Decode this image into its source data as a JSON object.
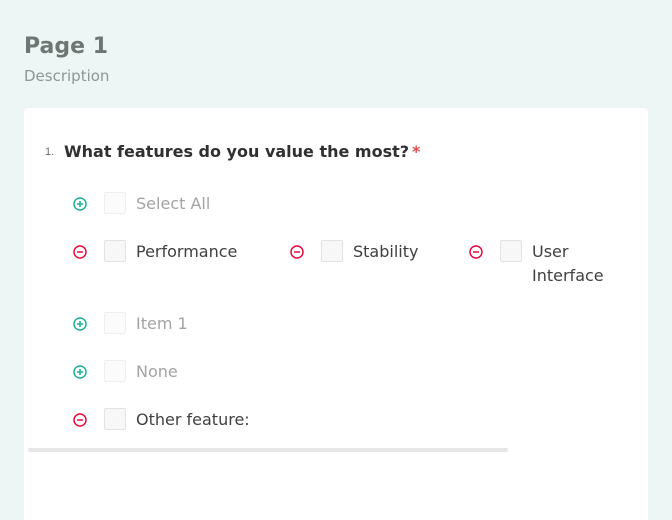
{
  "page": {
    "title": "Page 1",
    "description": "Description"
  },
  "question": {
    "number": "1.",
    "title": "What features do you value the most?",
    "required_mark": "*"
  },
  "options": {
    "select_all": "Select All",
    "performance": "Performance",
    "stability": "Stability",
    "user_interface_line1": "User",
    "user_interface_line2": "Interface",
    "item1": "Item 1",
    "none": "None",
    "other": "Other feature:"
  },
  "colors": {
    "add_icon": "#19b394",
    "remove_icon": "#e50a3e",
    "required": "#e2484e",
    "background": "#edf6f4"
  },
  "icons": {
    "add": "plus-circle-icon",
    "remove": "minus-circle-icon"
  }
}
